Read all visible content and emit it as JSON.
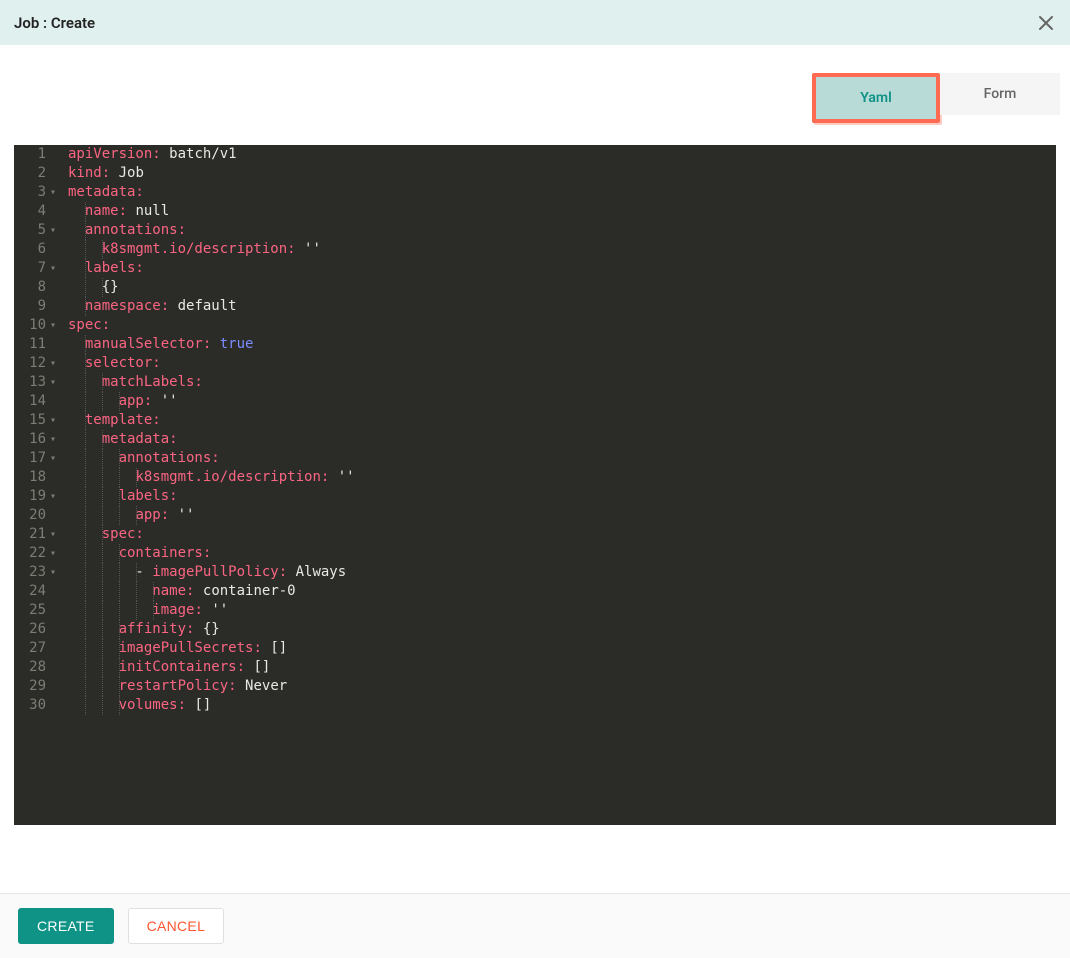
{
  "header": {
    "title": "Job : Create"
  },
  "tabs": {
    "yaml": "Yaml",
    "form": "Form",
    "active": "yaml"
  },
  "footer": {
    "create_label": "CREATE",
    "cancel_label": "CANCEL"
  },
  "editor": {
    "language": "yaml",
    "lines": [
      {
        "n": 1,
        "fold": false,
        "indent": 0,
        "tokens": [
          [
            "key",
            "apiVersion:"
          ],
          [
            "sp",
            " "
          ],
          [
            "val",
            "batch/v1"
          ]
        ]
      },
      {
        "n": 2,
        "fold": false,
        "indent": 0,
        "tokens": [
          [
            "key",
            "kind:"
          ],
          [
            "sp",
            " "
          ],
          [
            "val",
            "Job"
          ]
        ]
      },
      {
        "n": 3,
        "fold": true,
        "indent": 0,
        "tokens": [
          [
            "key",
            "metadata:"
          ]
        ]
      },
      {
        "n": 4,
        "fold": false,
        "indent": 1,
        "tokens": [
          [
            "key",
            "name:"
          ],
          [
            "sp",
            " "
          ],
          [
            "val",
            "null"
          ]
        ]
      },
      {
        "n": 5,
        "fold": true,
        "indent": 1,
        "tokens": [
          [
            "key",
            "annotations:"
          ]
        ]
      },
      {
        "n": 6,
        "fold": false,
        "indent": 2,
        "tokens": [
          [
            "key",
            "k8smgmt.io/description:"
          ],
          [
            "sp",
            " "
          ],
          [
            "str",
            "''"
          ]
        ]
      },
      {
        "n": 7,
        "fold": true,
        "indent": 1,
        "tokens": [
          [
            "key",
            "labels:"
          ]
        ]
      },
      {
        "n": 8,
        "fold": false,
        "indent": 2,
        "tokens": [
          [
            "punc",
            "{}"
          ]
        ]
      },
      {
        "n": 9,
        "fold": false,
        "indent": 1,
        "tokens": [
          [
            "key",
            "namespace:"
          ],
          [
            "sp",
            " "
          ],
          [
            "val",
            "default"
          ]
        ]
      },
      {
        "n": 10,
        "fold": true,
        "indent": 0,
        "tokens": [
          [
            "key",
            "spec:"
          ]
        ]
      },
      {
        "n": 11,
        "fold": false,
        "indent": 1,
        "tokens": [
          [
            "key",
            "manualSelector:"
          ],
          [
            "sp",
            " "
          ],
          [
            "bool",
            "true"
          ]
        ]
      },
      {
        "n": 12,
        "fold": true,
        "indent": 1,
        "tokens": [
          [
            "key",
            "selector:"
          ]
        ]
      },
      {
        "n": 13,
        "fold": true,
        "indent": 2,
        "tokens": [
          [
            "key",
            "matchLabels:"
          ]
        ]
      },
      {
        "n": 14,
        "fold": false,
        "indent": 3,
        "tokens": [
          [
            "key",
            "app:"
          ],
          [
            "sp",
            " "
          ],
          [
            "str",
            "''"
          ]
        ]
      },
      {
        "n": 15,
        "fold": true,
        "indent": 1,
        "tokens": [
          [
            "key",
            "template:"
          ]
        ]
      },
      {
        "n": 16,
        "fold": true,
        "indent": 2,
        "tokens": [
          [
            "key",
            "metadata:"
          ]
        ]
      },
      {
        "n": 17,
        "fold": true,
        "indent": 3,
        "tokens": [
          [
            "key",
            "annotations:"
          ]
        ]
      },
      {
        "n": 18,
        "fold": false,
        "indent": 4,
        "tokens": [
          [
            "key",
            "k8smgmt.io/description:"
          ],
          [
            "sp",
            " "
          ],
          [
            "str",
            "''"
          ]
        ]
      },
      {
        "n": 19,
        "fold": true,
        "indent": 3,
        "tokens": [
          [
            "key",
            "labels:"
          ]
        ]
      },
      {
        "n": 20,
        "fold": false,
        "indent": 4,
        "tokens": [
          [
            "key",
            "app:"
          ],
          [
            "sp",
            " "
          ],
          [
            "str",
            "''"
          ]
        ]
      },
      {
        "n": 21,
        "fold": true,
        "indent": 2,
        "tokens": [
          [
            "key",
            "spec:"
          ]
        ]
      },
      {
        "n": 22,
        "fold": true,
        "indent": 3,
        "tokens": [
          [
            "key",
            "containers:"
          ]
        ]
      },
      {
        "n": 23,
        "fold": true,
        "indent": 4,
        "dash": true,
        "tokens": [
          [
            "key",
            "imagePullPolicy:"
          ],
          [
            "sp",
            " "
          ],
          [
            "val",
            "Always"
          ]
        ]
      },
      {
        "n": 24,
        "fold": false,
        "indent": 5,
        "tokens": [
          [
            "key",
            "name:"
          ],
          [
            "sp",
            " "
          ],
          [
            "val",
            "container-0"
          ]
        ]
      },
      {
        "n": 25,
        "fold": false,
        "indent": 5,
        "tokens": [
          [
            "key",
            "image:"
          ],
          [
            "sp",
            " "
          ],
          [
            "str",
            "''"
          ]
        ]
      },
      {
        "n": 26,
        "fold": false,
        "indent": 3,
        "tokens": [
          [
            "key",
            "affinity:"
          ],
          [
            "sp",
            " "
          ],
          [
            "punc",
            "{}"
          ]
        ]
      },
      {
        "n": 27,
        "fold": false,
        "indent": 3,
        "tokens": [
          [
            "key",
            "imagePullSecrets:"
          ],
          [
            "sp",
            " "
          ],
          [
            "punc",
            "[]"
          ]
        ]
      },
      {
        "n": 28,
        "fold": false,
        "indent": 3,
        "tokens": [
          [
            "key",
            "initContainers:"
          ],
          [
            "sp",
            " "
          ],
          [
            "punc",
            "[]"
          ]
        ]
      },
      {
        "n": 29,
        "fold": false,
        "indent": 3,
        "tokens": [
          [
            "key",
            "restartPolicy:"
          ],
          [
            "sp",
            " "
          ],
          [
            "val",
            "Never"
          ]
        ]
      },
      {
        "n": 30,
        "fold": false,
        "indent": 3,
        "tokens": [
          [
            "key",
            "volumes:"
          ],
          [
            "sp",
            " "
          ],
          [
            "punc",
            "[]"
          ]
        ]
      }
    ]
  }
}
